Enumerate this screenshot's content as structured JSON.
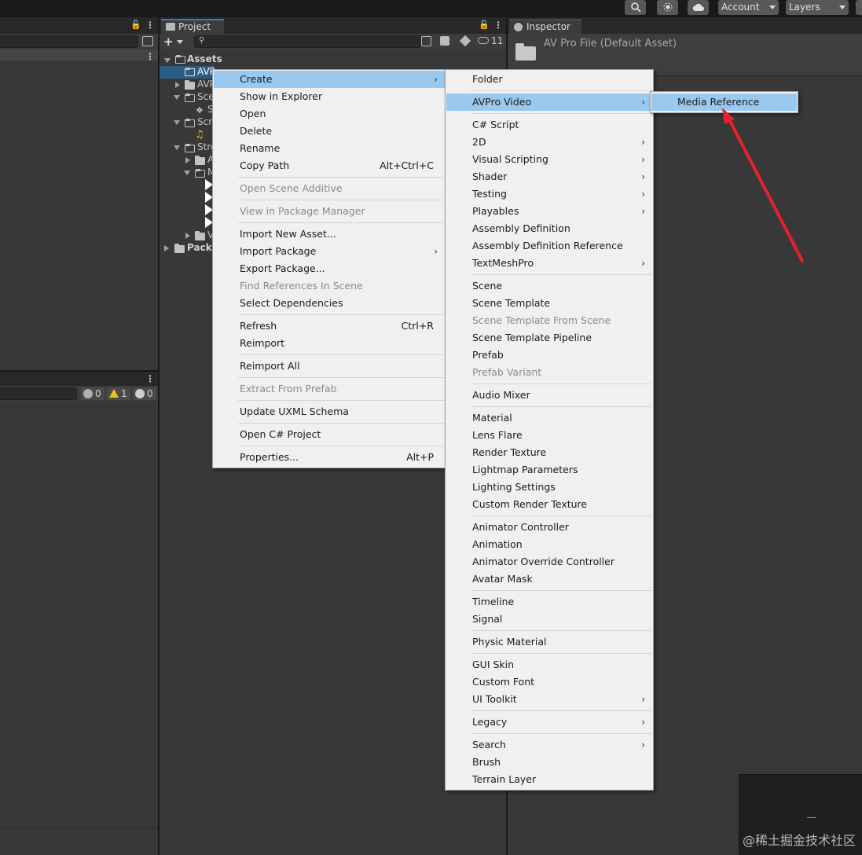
{
  "toolbar": {
    "account_label": "Account",
    "layers_label": "Layers",
    "search_icon": "search-icon",
    "services_icon": "services-icon",
    "cloud_icon": "cloud-icon"
  },
  "console_panel": {
    "error_count": "0",
    "warning_count": "1",
    "info_count": "0"
  },
  "project_panel": {
    "tab_label": "Project",
    "add_label": "+",
    "hidden_count": "11",
    "root_label": "Assets",
    "rows": [
      "AVP",
      "AVP",
      "Sce",
      "S",
      "Scr",
      "",
      "Stre",
      "A",
      "M",
      "V"
    ],
    "packages_label": "Packa"
  },
  "inspector": {
    "tab_label": "Inspector",
    "title": "AV Pro File (Default Asset)"
  },
  "context_menu": {
    "items": [
      {
        "label": "Create",
        "shortcut": "",
        "submenu": true,
        "disabled": false,
        "highlighted": true
      },
      {
        "label": "Show in Explorer",
        "shortcut": "",
        "submenu": false,
        "disabled": false
      },
      {
        "label": "Open",
        "shortcut": "",
        "submenu": false,
        "disabled": false
      },
      {
        "label": "Delete",
        "shortcut": "",
        "submenu": false,
        "disabled": false
      },
      {
        "label": "Rename",
        "shortcut": "",
        "submenu": false,
        "disabled": false
      },
      {
        "label": "Copy Path",
        "shortcut": "Alt+Ctrl+C",
        "submenu": false,
        "disabled": false
      },
      {
        "label": "Open Scene Additive",
        "shortcut": "",
        "submenu": false,
        "disabled": true
      },
      {
        "label": "View in Package Manager",
        "shortcut": "",
        "submenu": false,
        "disabled": true
      },
      {
        "label": "Import New Asset...",
        "shortcut": "",
        "submenu": false,
        "disabled": false
      },
      {
        "label": "Import Package",
        "shortcut": "",
        "submenu": true,
        "disabled": false
      },
      {
        "label": "Export Package...",
        "shortcut": "",
        "submenu": false,
        "disabled": false
      },
      {
        "label": "Find References In Scene",
        "shortcut": "",
        "submenu": false,
        "disabled": true
      },
      {
        "label": "Select Dependencies",
        "shortcut": "",
        "submenu": false,
        "disabled": false
      },
      {
        "label": "Refresh",
        "shortcut": "Ctrl+R",
        "submenu": false,
        "disabled": false
      },
      {
        "label": "Reimport",
        "shortcut": "",
        "submenu": false,
        "disabled": false
      },
      {
        "label": "Reimport All",
        "shortcut": "",
        "submenu": false,
        "disabled": false
      },
      {
        "label": "Extract From Prefab",
        "shortcut": "",
        "submenu": false,
        "disabled": true
      },
      {
        "label": "Update UXML Schema",
        "shortcut": "",
        "submenu": false,
        "disabled": false
      },
      {
        "label": "Open C# Project",
        "shortcut": "",
        "submenu": false,
        "disabled": false
      },
      {
        "label": "Properties...",
        "shortcut": "Alt+P",
        "submenu": false,
        "disabled": false
      }
    ]
  },
  "create_menu": {
    "items": [
      {
        "label": "Folder",
        "submenu": false,
        "disabled": false
      },
      {
        "label": "AVPro Video",
        "submenu": true,
        "disabled": false,
        "highlighted": true
      },
      {
        "label": "C# Script",
        "submenu": false,
        "disabled": false
      },
      {
        "label": "2D",
        "submenu": true,
        "disabled": false
      },
      {
        "label": "Visual Scripting",
        "submenu": true,
        "disabled": false
      },
      {
        "label": "Shader",
        "submenu": true,
        "disabled": false
      },
      {
        "label": "Testing",
        "submenu": true,
        "disabled": false
      },
      {
        "label": "Playables",
        "submenu": true,
        "disabled": false
      },
      {
        "label": "Assembly Definition",
        "submenu": false,
        "disabled": false
      },
      {
        "label": "Assembly Definition Reference",
        "submenu": false,
        "disabled": false
      },
      {
        "label": "TextMeshPro",
        "submenu": true,
        "disabled": false
      },
      {
        "label": "Scene",
        "submenu": false,
        "disabled": false
      },
      {
        "label": "Scene Template",
        "submenu": false,
        "disabled": false
      },
      {
        "label": "Scene Template From Scene",
        "submenu": false,
        "disabled": true
      },
      {
        "label": "Scene Template Pipeline",
        "submenu": false,
        "disabled": false
      },
      {
        "label": "Prefab",
        "submenu": false,
        "disabled": false
      },
      {
        "label": "Prefab Variant",
        "submenu": false,
        "disabled": true
      },
      {
        "label": "Audio Mixer",
        "submenu": false,
        "disabled": false
      },
      {
        "label": "Material",
        "submenu": false,
        "disabled": false
      },
      {
        "label": "Lens Flare",
        "submenu": false,
        "disabled": false
      },
      {
        "label": "Render Texture",
        "submenu": false,
        "disabled": false
      },
      {
        "label": "Lightmap Parameters",
        "submenu": false,
        "disabled": false
      },
      {
        "label": "Lighting Settings",
        "submenu": false,
        "disabled": false
      },
      {
        "label": "Custom Render Texture",
        "submenu": false,
        "disabled": false
      },
      {
        "label": "Animator Controller",
        "submenu": false,
        "disabled": false
      },
      {
        "label": "Animation",
        "submenu": false,
        "disabled": false
      },
      {
        "label": "Animator Override Controller",
        "submenu": false,
        "disabled": false
      },
      {
        "label": "Avatar Mask",
        "submenu": false,
        "disabled": false
      },
      {
        "label": "Timeline",
        "submenu": false,
        "disabled": false
      },
      {
        "label": "Signal",
        "submenu": false,
        "disabled": false
      },
      {
        "label": "Physic Material",
        "submenu": false,
        "disabled": false
      },
      {
        "label": "GUI Skin",
        "submenu": false,
        "disabled": false
      },
      {
        "label": "Custom Font",
        "submenu": false,
        "disabled": false
      },
      {
        "label": "UI Toolkit",
        "submenu": true,
        "disabled": false
      },
      {
        "label": "Legacy",
        "submenu": true,
        "disabled": false
      },
      {
        "label": "Search",
        "submenu": true,
        "disabled": false
      },
      {
        "label": "Brush",
        "submenu": false,
        "disabled": false
      },
      {
        "label": "Terrain Layer",
        "submenu": false,
        "disabled": false
      }
    ]
  },
  "avpro_menu": {
    "items": [
      {
        "label": "Media Reference",
        "highlighted": true
      }
    ]
  },
  "annotation": {
    "arrow_color": "#e8202a"
  },
  "watermark": "@稀土掘金技术社区",
  "colors": {
    "menu_highlight": "#99c9ef",
    "tab_accent": "#3a79bb"
  }
}
